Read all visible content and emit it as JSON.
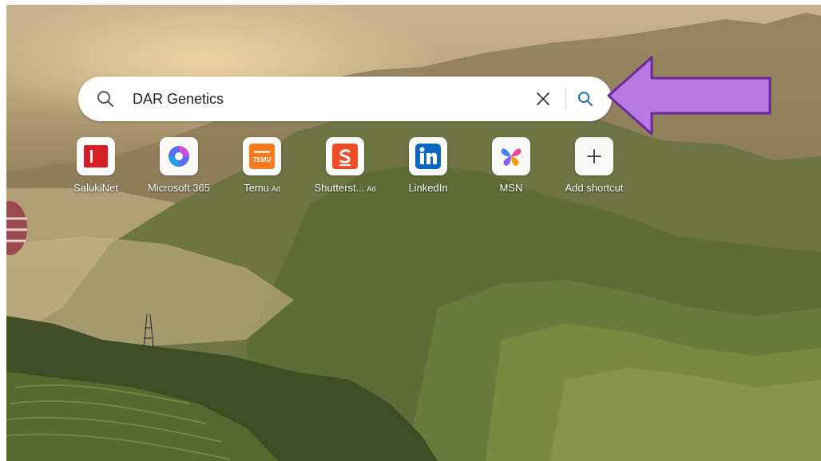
{
  "search": {
    "query": "DAR Genetics",
    "clear_icon": "close-icon",
    "submit_icon": "search-icon"
  },
  "shortcuts": [
    {
      "label": "SalukiNet",
      "ad": "",
      "icon": "salukinet-icon",
      "color": "#d61f26"
    },
    {
      "label": "Microsoft 365",
      "ad": "",
      "icon": "microsoft-365-icon",
      "color": "#7b5cf5"
    },
    {
      "label": "Temu",
      "ad": "Ad",
      "icon": "temu-icon",
      "color": "#f47a20"
    },
    {
      "label": "Shutterst...",
      "ad": "Ad",
      "icon": "shutterstock-icon",
      "color": "#ee4b29"
    },
    {
      "label": "LinkedIn",
      "ad": "",
      "icon": "linkedin-icon",
      "color": "#0a66c2"
    },
    {
      "label": "MSN",
      "ad": "",
      "icon": "msn-icon",
      "color": "#3b82f6"
    },
    {
      "label": "Add shortcut",
      "ad": "",
      "icon": "plus-icon",
      "color": "#333333"
    }
  ],
  "annotation": {
    "arrow_color": "#b57be0",
    "arrow_border": "#6a2a9c"
  },
  "temu_logo_text": "TEMU"
}
